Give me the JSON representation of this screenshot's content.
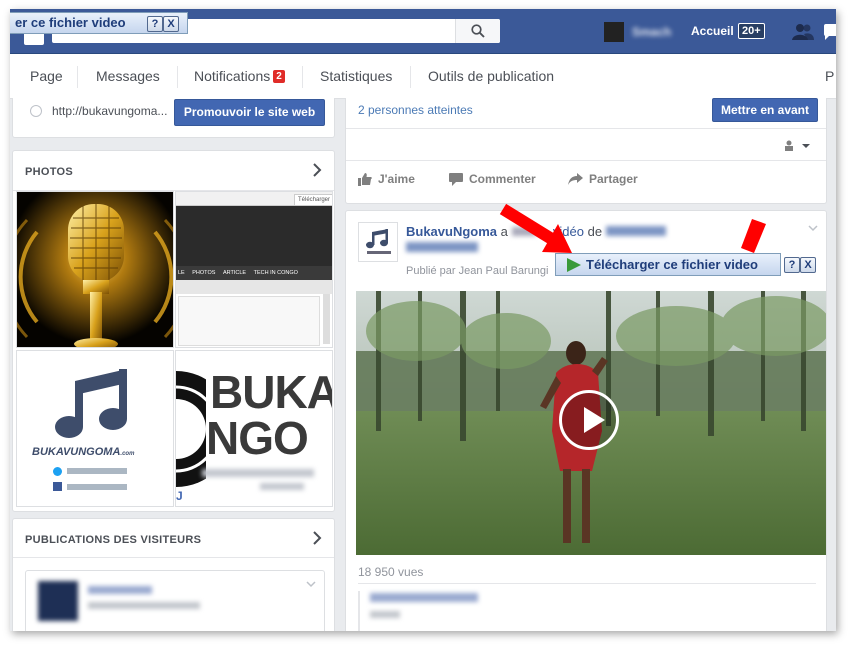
{
  "top_bar": {
    "download_label": "er ce fichier video",
    "help_label": "?",
    "close_label": "X",
    "nav_home": "Accueil",
    "nav_count": "20+"
  },
  "page_tabs": {
    "page": "Page",
    "messages": "Messages",
    "notifications": "Notifications",
    "notifications_badge": "2",
    "statistics": "Statistiques",
    "publishing_tools": "Outils de publication",
    "more": "P"
  },
  "sidebar": {
    "promo_url": "http://bukavungoma...",
    "promo_button": "Promouvoir le site web",
    "photos_title": "PHOTOS",
    "photo_logo_text": "BUKAVUNGOMA",
    "photo_logo_suffix": ".com",
    "photo_site_text": "BUKA",
    "photo_site_text2": "NGO",
    "photo_site_letter": "J",
    "photo_screenshot_menu": [
      "LE",
      "PHOTOS",
      "ARTICLE",
      "TECH IN CONGO"
    ],
    "photo_screenshot_tab": "Télécharger",
    "visitors_title": "PUBLICATIONS DES VISITEURS"
  },
  "top_post": {
    "reach": "2 personnes atteintes",
    "boost_button": "Mettre en avant",
    "like": "J'aime",
    "comment": "Commenter",
    "share": "Partager"
  },
  "post": {
    "page_name": "BukavuNgoma",
    "action_text_1": "a",
    "action_text_2": "la",
    "video_word": "vidéo",
    "de_word": "de",
    "published_by": "Publié par Jean Paul Barungi",
    "download_button": "Télécharger ce fichier video",
    "help_label": "?",
    "close_label": "X",
    "views": "18 950 vues"
  },
  "colors": {
    "facebook_blue": "#3b5998",
    "button_blue": "#4267b2",
    "badge_red": "#e02c28",
    "arrow_red": "#ff0000",
    "download_green": "#3a9a3a"
  }
}
